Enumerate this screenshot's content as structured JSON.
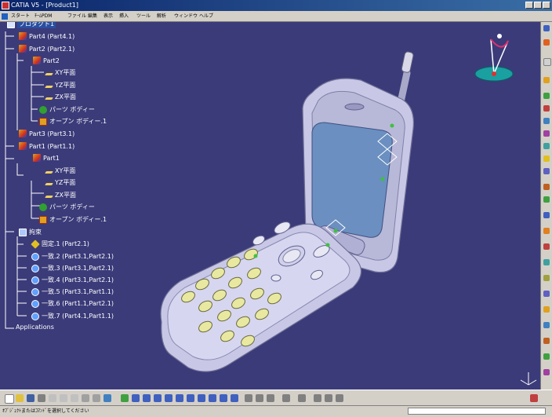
{
  "window": {
    "title": "CATIA V5 - [Product1]"
  },
  "menu": [
    "スタート",
    "ﾁｰﾑPDM",
    "ファイル",
    "編集",
    "表示",
    "挿入",
    "ツール",
    "解析",
    "ウィンドウ",
    "ヘルプ"
  ],
  "tree": [
    {
      "label": "プロダクト1",
      "icon": "product-icon",
      "selected": true
    },
    {
      "label": "Part4 (Part4.1)",
      "icon": "part-icon"
    },
    {
      "label": "Part2 (Part2.1)",
      "icon": "part-icon"
    },
    {
      "label": "Part2",
      "icon": "part-icon"
    },
    {
      "label": "XY平面",
      "icon": "plane-icon"
    },
    {
      "label": "YZ平面",
      "icon": "plane-icon"
    },
    {
      "label": "ZX平面",
      "icon": "plane-icon"
    },
    {
      "label": "パーツ ボディー",
      "icon": "body-icon"
    },
    {
      "label": "オープン ボディー.1",
      "icon": "open-body-icon"
    },
    {
      "label": "Part3 (Part3.1)",
      "icon": "part-icon"
    },
    {
      "label": "Part1 (Part1.1)",
      "icon": "part-icon"
    },
    {
      "label": "Part1",
      "icon": "part-icon"
    },
    {
      "label": "XY平面",
      "icon": "plane-icon"
    },
    {
      "label": "YZ平面",
      "icon": "plane-icon"
    },
    {
      "label": "ZX平面",
      "icon": "plane-icon"
    },
    {
      "label": "パーツ ボディー",
      "icon": "body-icon"
    },
    {
      "label": "オープン ボディー.1",
      "icon": "open-body-icon"
    },
    {
      "label": "拘束",
      "icon": "constraints-icon"
    },
    {
      "label": "固定.1 (Part2.1)",
      "icon": "fix-icon"
    },
    {
      "label": "一致.2 (Part3.1,Part2.1)",
      "icon": "coincidence-icon"
    },
    {
      "label": "一致.3 (Part3.1,Part2.1)",
      "icon": "coincidence-icon"
    },
    {
      "label": "一致.4 (Part3.1,Part2.1)",
      "icon": "coincidence-icon"
    },
    {
      "label": "一致.5 (Part3.1,Part1.1)",
      "icon": "coincidence-icon"
    },
    {
      "label": "一致.6 (Part1.1,Part2.1)",
      "icon": "coincidence-icon"
    },
    {
      "label": "一致.7 (Part4.1,Part1.1)",
      "icon": "coincidence-icon"
    },
    {
      "label": "Applications",
      "icon": ""
    }
  ],
  "status": {
    "message": "ｵﾌﾞｼﾞｪｸﾄまたはｺﾏﾝﾄﾞを選択してください"
  },
  "colors": {
    "background": "#3b3b7a",
    "phone_body": "#c8c8e8",
    "screen": "#6a8fc0",
    "keys": "#e8e8a0"
  }
}
